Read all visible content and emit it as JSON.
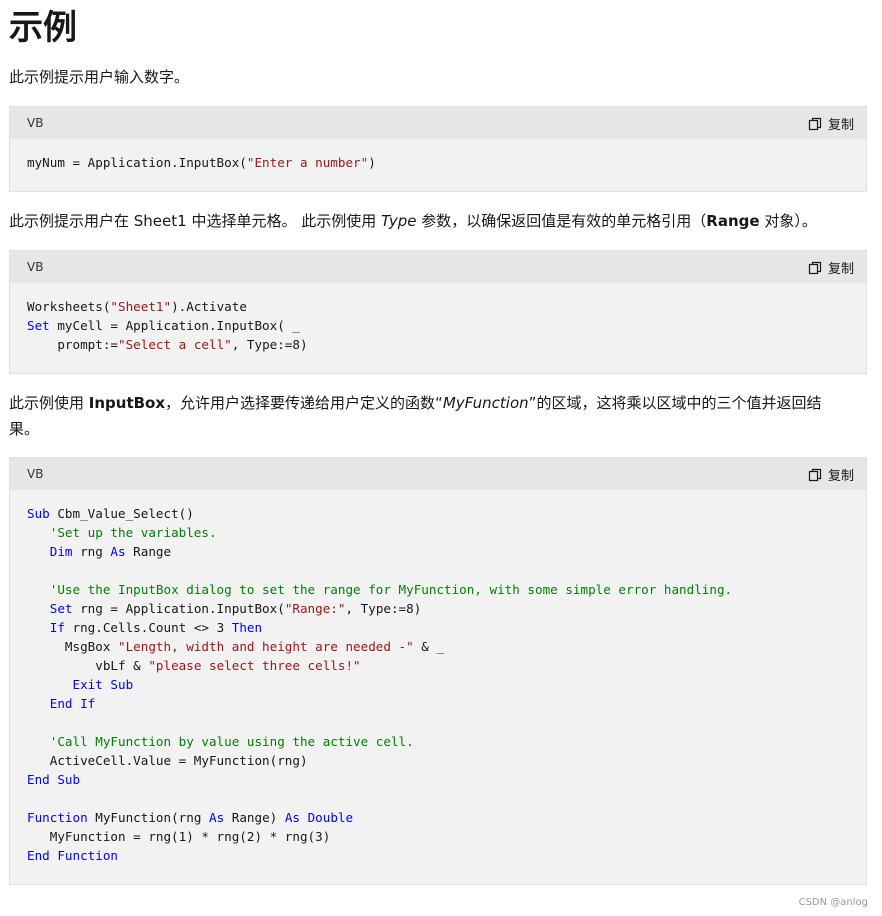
{
  "heading": "示例",
  "intro_1": "此示例提示用户输入数字。",
  "para_2": {
    "p1": "此示例提示用户在 Sheet1 中选择单元格。 此示例使用 ",
    "type_word": "Type",
    "p2": " 参数，以确保返回值是有效的单元格引用（",
    "range_word": "Range",
    "p3": " 对象）。"
  },
  "para_3": {
    "p1": "此示例使用 ",
    "inputbox_word": "InputBox",
    "p2": "，允许用户选择要传递给用户定义的函数“",
    "func_word": "MyFunction",
    "p3": "”的区域，这将乘以区域中的三个值并返回结",
    "p4": "果。"
  },
  "code_blocks": [
    {
      "lang": "VB",
      "copy_label": "复制",
      "lines": [
        [
          [
            "t",
            "myNum = Application.InputBox("
          ],
          [
            "s",
            "\"Enter a number\""
          ],
          [
            "t",
            ")"
          ]
        ]
      ]
    },
    {
      "lang": "VB",
      "copy_label": "复制",
      "lines": [
        [
          [
            "t",
            "Worksheets("
          ],
          [
            "s",
            "\"Sheet1\""
          ],
          [
            "t",
            ").Activate"
          ]
        ],
        [
          [
            "k",
            "Set"
          ],
          [
            "t",
            " myCell = Application.InputBox( _"
          ]
        ],
        [
          [
            "t",
            "    prompt:="
          ],
          [
            "s",
            "\"Select a cell\""
          ],
          [
            "t",
            ", Type:=8)"
          ]
        ]
      ]
    },
    {
      "lang": "VB",
      "copy_label": "复制",
      "lines": [
        [
          [
            "k",
            "Sub"
          ],
          [
            "t",
            " Cbm_Value_Select()"
          ]
        ],
        [
          [
            "t",
            "   "
          ],
          [
            "c",
            "'Set up the variables."
          ]
        ],
        [
          [
            "t",
            "   "
          ],
          [
            "k",
            "Dim"
          ],
          [
            "t",
            " rng "
          ],
          [
            "k",
            "As"
          ],
          [
            "t",
            " Range"
          ]
        ],
        [],
        [
          [
            "t",
            "   "
          ],
          [
            "c",
            "'Use the InputBox dialog to set the range for MyFunction, with some simple error handling."
          ]
        ],
        [
          [
            "t",
            "   "
          ],
          [
            "k",
            "Set"
          ],
          [
            "t",
            " rng = Application.InputBox("
          ],
          [
            "s",
            "\"Range:\""
          ],
          [
            "t",
            ", Type:=8)"
          ]
        ],
        [
          [
            "t",
            "   "
          ],
          [
            "k",
            "If"
          ],
          [
            "t",
            " rng.Cells.Count <> 3 "
          ],
          [
            "k",
            "Then"
          ]
        ],
        [
          [
            "t",
            "     MsgBox "
          ],
          [
            "s",
            "\"Length, width and height are needed -\""
          ],
          [
            "t",
            " & _"
          ]
        ],
        [
          [
            "t",
            "         vbLf & "
          ],
          [
            "s",
            "\"please select three cells!\""
          ]
        ],
        [
          [
            "t",
            "      "
          ],
          [
            "k",
            "Exit Sub"
          ]
        ],
        [
          [
            "t",
            "   "
          ],
          [
            "k",
            "End If"
          ]
        ],
        [],
        [
          [
            "t",
            "   "
          ],
          [
            "c",
            "'Call MyFunction by value using the active cell."
          ]
        ],
        [
          [
            "t",
            "   ActiveCell.Value = MyFunction(rng)"
          ]
        ],
        [
          [
            "k",
            "End Sub"
          ]
        ],
        [],
        [
          [
            "k",
            "Function"
          ],
          [
            "t",
            " MyFunction(rng "
          ],
          [
            "k",
            "As"
          ],
          [
            "t",
            " Range) "
          ],
          [
            "k",
            "As Double"
          ]
        ],
        [
          [
            "t",
            "   MyFunction = rng(1) * rng(2) * rng(3)"
          ]
        ],
        [
          [
            "k",
            "End Function"
          ]
        ]
      ]
    }
  ],
  "watermark": "CSDN @anlog"
}
